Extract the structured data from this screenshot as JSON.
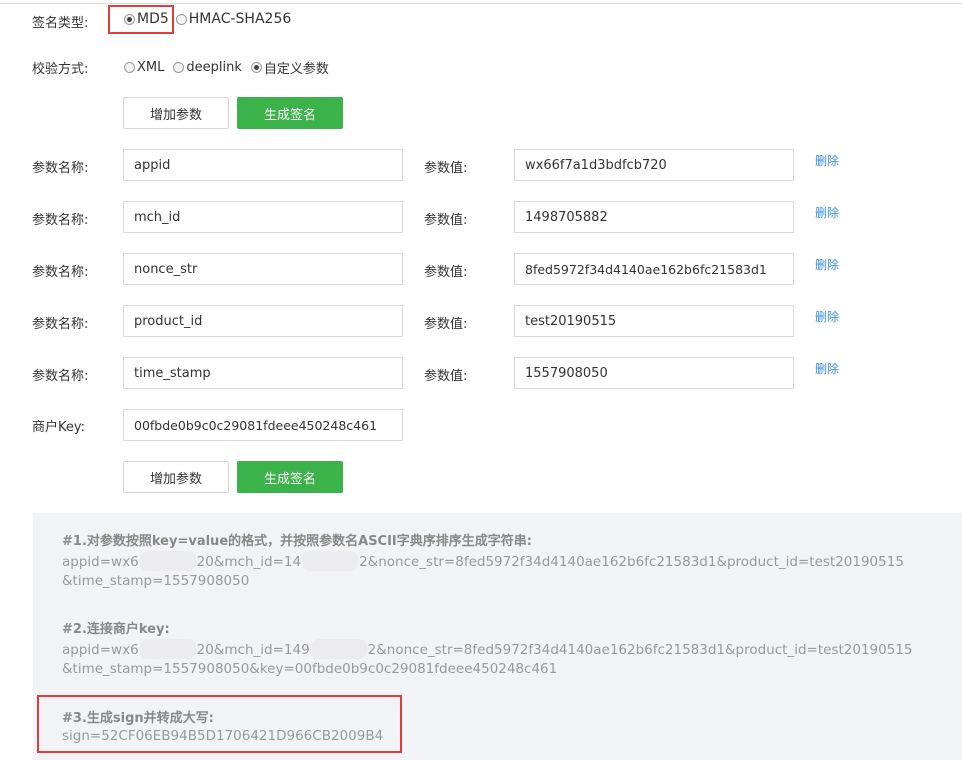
{
  "sign_type": {
    "label": "签名类型:",
    "options": [
      "MD5",
      "HMAC-SHA256"
    ],
    "selected": "MD5"
  },
  "verify_mode": {
    "label": "校验方式:",
    "options": [
      "XML",
      "deeplink",
      "自定义参数"
    ],
    "selected": "自定义参数"
  },
  "buttons": {
    "add_param": "增加参数",
    "gen_sign": "生成签名"
  },
  "params": {
    "name_label": "参数名称:",
    "value_label": "参数值:",
    "delete_label": "删除",
    "rows": [
      {
        "name": "appid",
        "value": "wx66f7a1d3bdfcb720"
      },
      {
        "name": "mch_id",
        "value": "1498705882"
      },
      {
        "name": "nonce_str",
        "value": "8fed5972f34d4140ae162b6fc21583d1"
      },
      {
        "name": "product_id",
        "value": "test20190515"
      },
      {
        "name": "time_stamp",
        "value": "1557908050"
      }
    ]
  },
  "merchant_key": {
    "label": "商户Key:",
    "value": "00fbde0b9c0c29081fdeee450248c461"
  },
  "result": {
    "step1_title": "#1.对参数按照key=value的格式，并按照参数名ASCII字典序排序生成字符串:",
    "step1_line1_a": "appid=wx6",
    "step1_line1_b": "20&mch_id=14",
    "step1_line1_c": "2&nonce_str=8fed5972f34d4140ae162b6fc21583d1&product_id=test20190515",
    "step1_line2": "&time_stamp=1557908050",
    "step2_title": "#2.连接商户key:",
    "step2_line1_a": "appid=wx6",
    "step2_line1_b": "20&mch_id=149",
    "step2_line1_c": "2&nonce_str=8fed5972f34d4140ae162b6fc21583d1&product_id=test20190515",
    "step2_line2": "&time_stamp=1557908050&key=00fbde0b9c0c29081fdeee450248c461",
    "step3_title": "#3.生成sign并转成大写:",
    "step3_value": "sign=52CF06EB94B5D1706421D966CB2009B4"
  },
  "colors": {
    "primary_green": "#3cb34a",
    "link_blue": "#3a8ee6",
    "highlight_red": "#e23b3b"
  }
}
